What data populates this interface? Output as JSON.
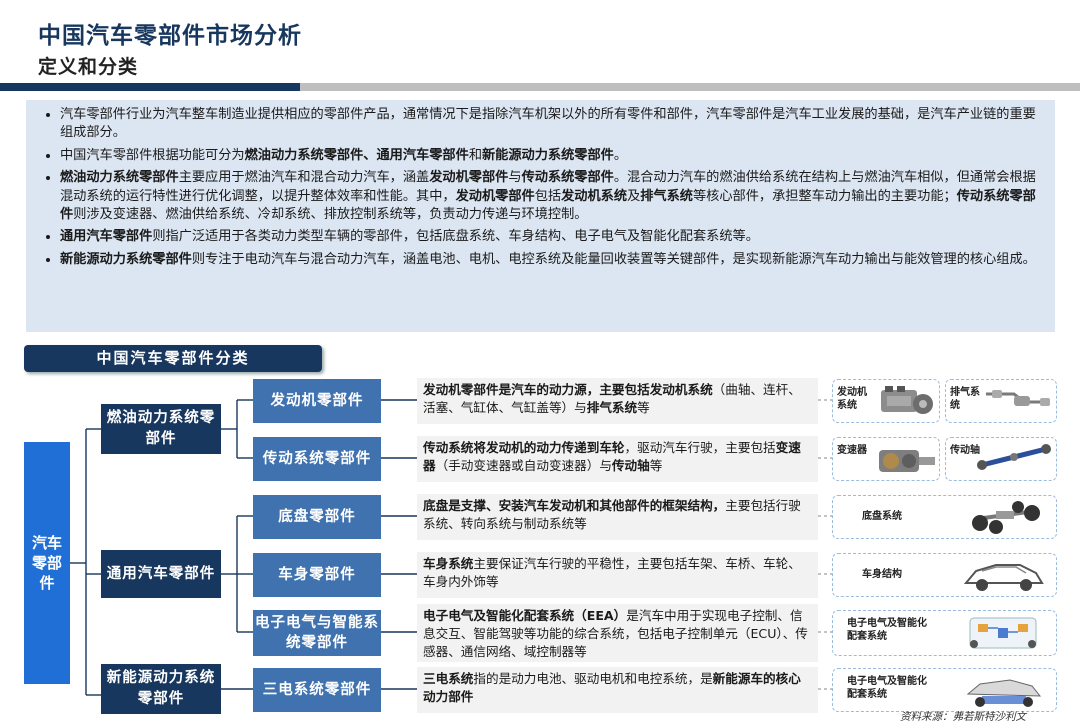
{
  "header": {
    "title": "中国汽车零部件市场分析",
    "subtitle": "定义和分类"
  },
  "bullets": [
    [
      {
        "t": "汽车零部件行业为汽车整车制造业提供相应的零部件产品，通常情况下是指除汽车机架以外的所有零件和部件，汽车零部件是汽车工业发展的基础，是汽车产业链的重要组成部分。",
        "b": false
      }
    ],
    [
      {
        "t": "中国汽车零部件根据功能可分为",
        "b": false
      },
      {
        "t": "燃油动力系统零部件、通用汽车零部件",
        "b": true
      },
      {
        "t": "和",
        "b": false
      },
      {
        "t": "新能源动力系统零部件",
        "b": true
      },
      {
        "t": "。",
        "b": false
      }
    ],
    [
      {
        "t": "燃油动力系统零部件",
        "b": true
      },
      {
        "t": "主要应用于燃油汽车和混合动力汽车，涵盖",
        "b": false
      },
      {
        "t": "发动机零部件",
        "b": true
      },
      {
        "t": "与",
        "b": false
      },
      {
        "t": "传动系统零部件",
        "b": true
      },
      {
        "t": "。混合动力汽车的燃油供给系统在结构上与燃油汽车相似，但通常会根据混动系统的运行特性进行优化调整，以提升整体效率和性能。其中，",
        "b": false
      },
      {
        "t": "发动机零部件",
        "b": true
      },
      {
        "t": "包括",
        "b": false
      },
      {
        "t": "发动机系统",
        "b": true
      },
      {
        "t": "及",
        "b": false
      },
      {
        "t": "排气系统",
        "b": true
      },
      {
        "t": "等核心部件，承担整车动力输出的主要功能；",
        "b": false
      },
      {
        "t": "传动系统零部件",
        "b": true
      },
      {
        "t": "则涉及变速器、燃油供给系统、冷却系统、排放控制系统等，负责动力传递与环境控制。",
        "b": false
      }
    ],
    [
      {
        "t": "通用汽车零部件",
        "b": true
      },
      {
        "t": "则指广泛适用于各类动力类型车辆的零部件，包括底盘系统、车身结构、电子电气及智能化配套系统等。",
        "b": false
      }
    ],
    [
      {
        "t": "新能源动力系统零部件",
        "b": true
      },
      {
        "t": "则专注于电动汽车与混合动力汽车，涵盖电池、电机、电控系统及能量回收装置等关键部件，是实现新能源汽车动力输出与能效管理的核心组成。",
        "b": false
      }
    ]
  ],
  "section_tab": "中国汽车零部件分类",
  "tree": {
    "root": "汽车零部件",
    "level1": [
      {
        "label": "燃油动力系统零部件"
      },
      {
        "label": "通用汽车零部件"
      },
      {
        "label": "新能源动力系统零部件"
      }
    ],
    "level2": [
      {
        "label": "发动机零部件",
        "desc": [
          {
            "t": "发动机零部件是汽车的动力源，主要包括",
            "b": true
          },
          {
            "t": "发动机系统",
            "b": true
          },
          {
            "t": "（曲轴、连杆、活塞、气缸体、气缸盖等）与",
            "b": false
          },
          {
            "t": "排气系统",
            "b": true
          },
          {
            "t": "等",
            "b": false
          }
        ],
        "images": [
          {
            "label": "发动机系统",
            "icon": "engine-icon"
          },
          {
            "label": "排气系统",
            "icon": "exhaust-icon"
          }
        ]
      },
      {
        "label": "传动系统零部件",
        "desc": [
          {
            "t": "传动系统将发动机的动力传递到车轮",
            "b": true
          },
          {
            "t": "，驱动汽车行驶，主要包括",
            "b": false
          },
          {
            "t": "变速器",
            "b": true
          },
          {
            "t": "（手动变速器或自动变速器）与",
            "b": false
          },
          {
            "t": "传动轴",
            "b": true
          },
          {
            "t": "等",
            "b": false
          }
        ],
        "images": [
          {
            "label": "变速器",
            "icon": "gearbox-icon"
          },
          {
            "label": "传动轴",
            "icon": "driveshaft-icon"
          }
        ]
      },
      {
        "label": "底盘零部件",
        "desc": [
          {
            "t": "底盘是支撑、安装汽车发动机和其他部件的框架结构，",
            "b": true
          },
          {
            "t": "主要包括行驶系统、转向系统与制动系统等",
            "b": false
          }
        ],
        "images": [
          {
            "label": "底盘系统",
            "icon": "chassis-icon"
          }
        ]
      },
      {
        "label": "车身零部件",
        "desc": [
          {
            "t": "车身系统",
            "b": true
          },
          {
            "t": "主要保证汽车行驶的平稳性，主要包括车架、车桥、车轮、车身内外饰等",
            "b": false
          }
        ],
        "images": [
          {
            "label": "车身结构",
            "icon": "car-body-icon"
          }
        ]
      },
      {
        "label": "电子电气与智能系统零部件",
        "desc": [
          {
            "t": "电子电气及智能化配套系统（EEA）",
            "b": true
          },
          {
            "t": "是汽车中用于实现电子控制、信息交互、智能驾驶等功能的综合系统，包括电子控制单元（ECU）、传感器、通信网络、域控制器等",
            "b": false
          }
        ],
        "images": [
          {
            "label": "电子电气及智能化配套系统",
            "icon": "electronics-icon"
          }
        ]
      },
      {
        "label": "三电系统零部件",
        "desc": [
          {
            "t": "三电系统",
            "b": true
          },
          {
            "t": "指的是动力电池、驱动电机和电控系统，是",
            "b": false
          },
          {
            "t": "新能源车的核心动力部件",
            "b": true
          }
        ],
        "images": [
          {
            "label": "电子电气及智能化配套系统",
            "icon": "ev-platform-icon"
          }
        ]
      }
    ]
  },
  "source": "资料来源：弗若斯特沙利文",
  "colors": {
    "navy": "#17375e",
    "mid_blue": "#3f72af",
    "root_blue": "#1f6fd6",
    "panel": "#dce6f2"
  }
}
